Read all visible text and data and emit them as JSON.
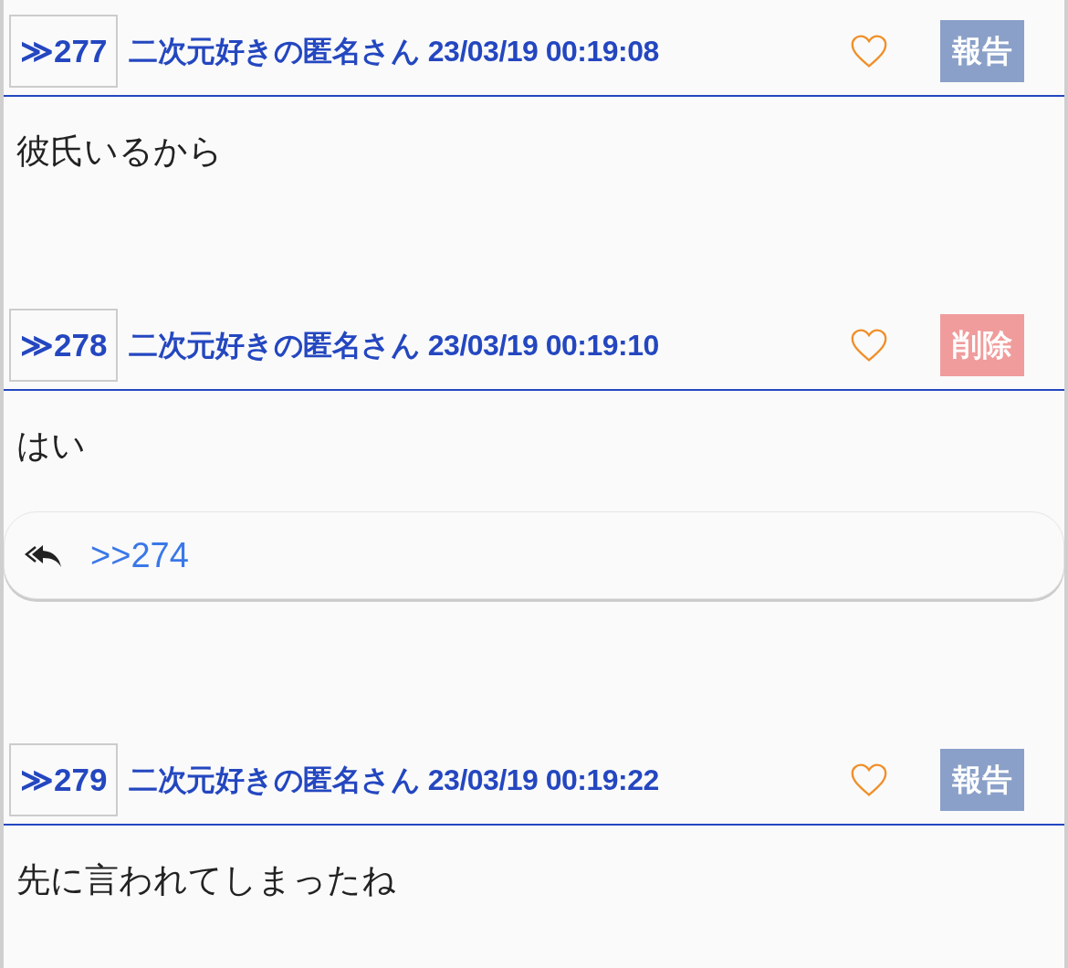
{
  "posts": [
    {
      "number": "≫277",
      "author_time": "二次元好きの匿名さん 23/03/19 00:19:08",
      "liked": false,
      "action": {
        "kind": "report",
        "label": "報告"
      },
      "body": "彼氏いるから"
    },
    {
      "number": "≫278",
      "author_time": "二次元好きの匿名さん 23/03/19 00:19:10",
      "liked": false,
      "action": {
        "kind": "delete",
        "label": "削除"
      },
      "body": "はい",
      "reply": ">>274"
    },
    {
      "number": "≫279",
      "author_time": "二次元好きの匿名さん 23/03/19 00:19:22",
      "liked": false,
      "action": {
        "kind": "report",
        "label": "報告"
      },
      "body": "先に言われてしまったね"
    }
  ]
}
